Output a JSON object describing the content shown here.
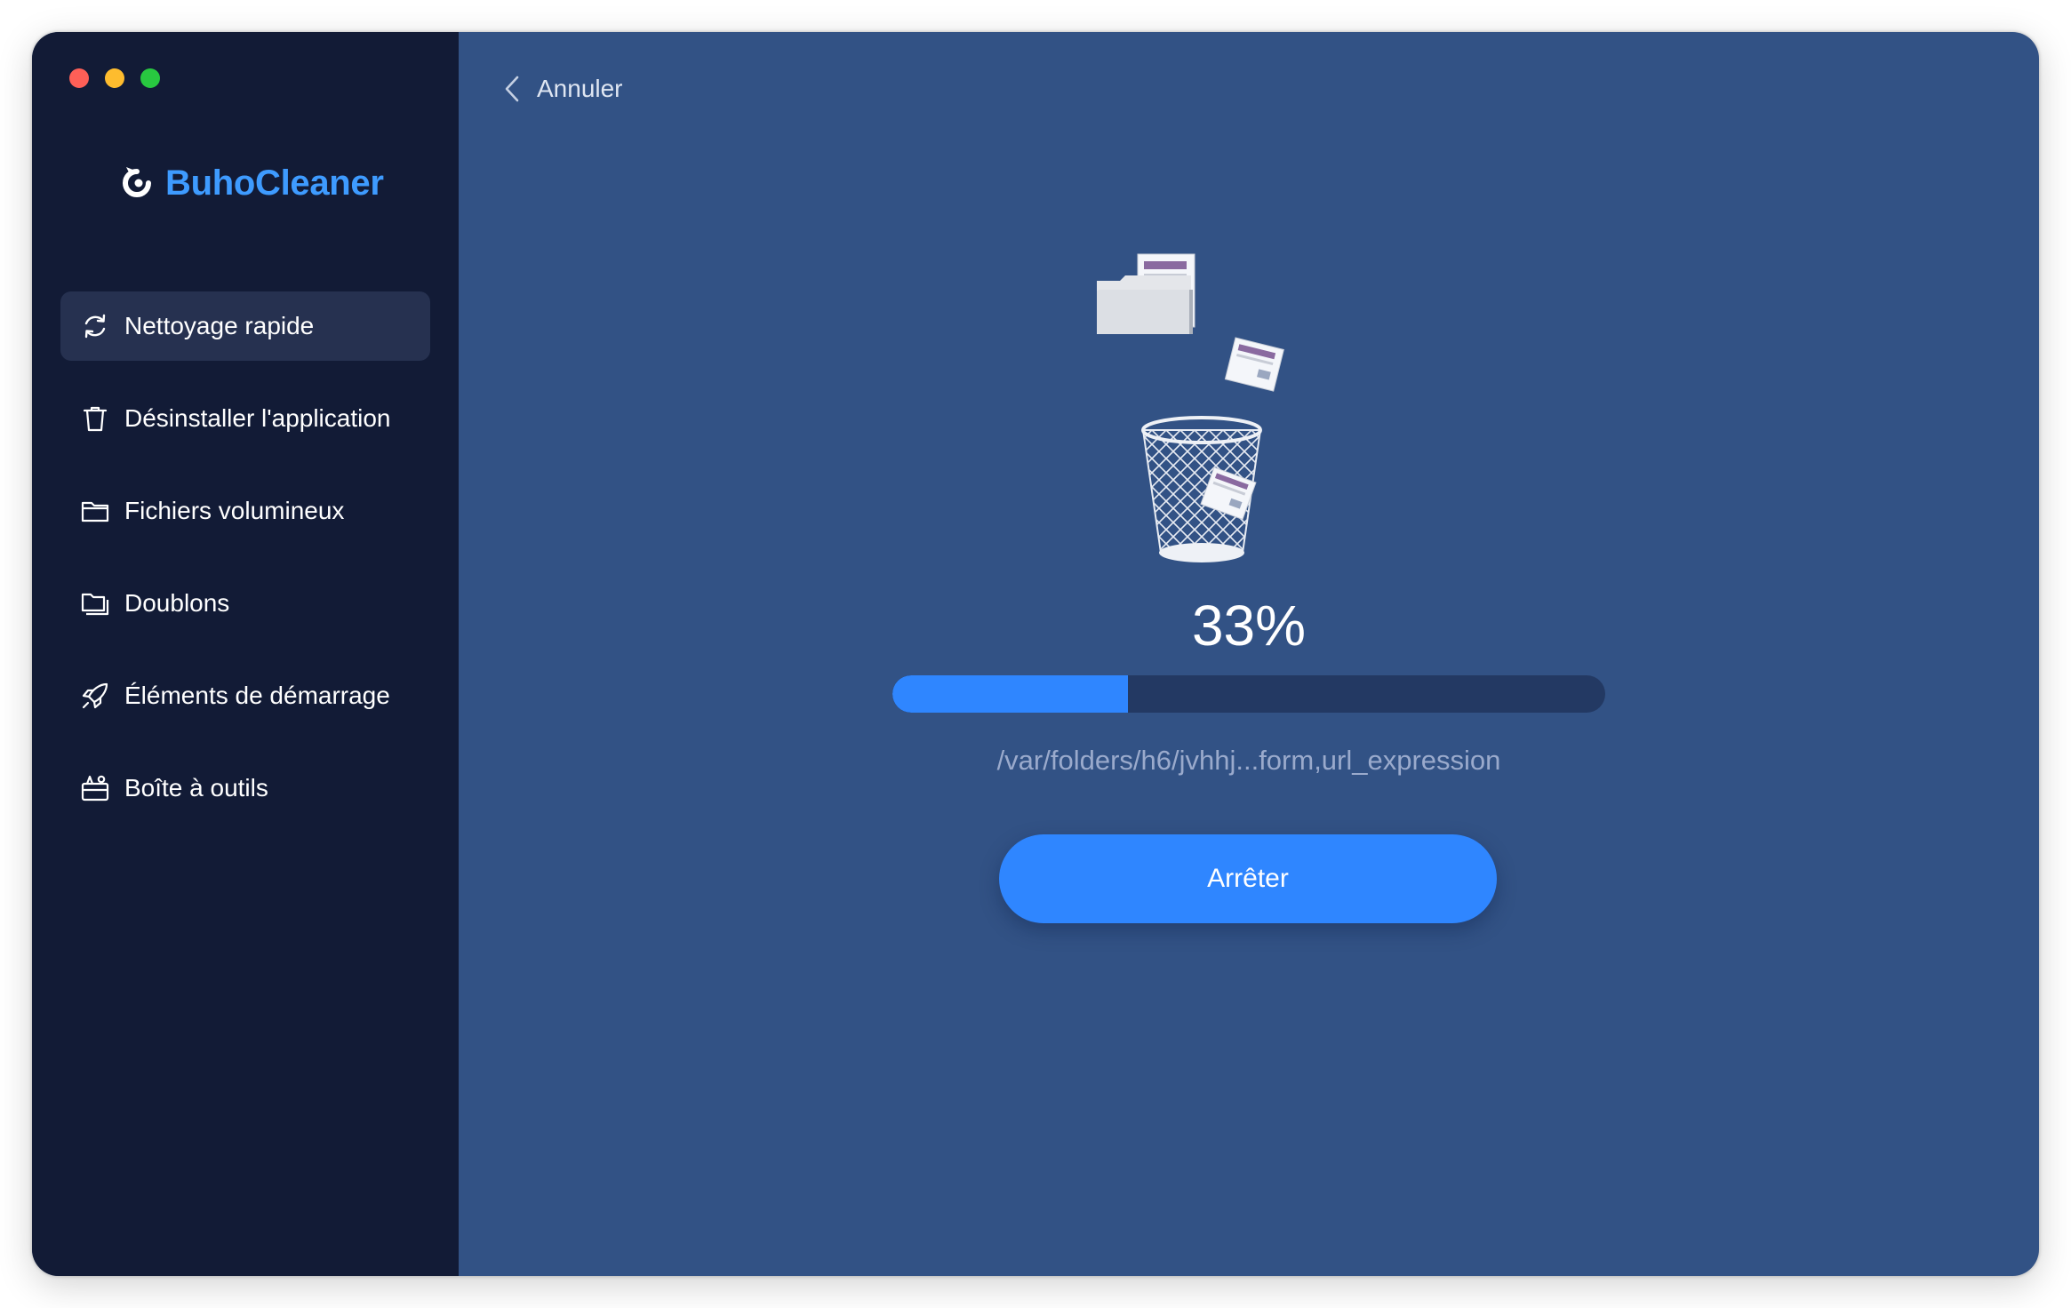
{
  "app": {
    "name": "BuhoCleaner",
    "brand_color": "#3e9bff"
  },
  "sidebar": {
    "items": [
      {
        "label": "Nettoyage rapide",
        "icon": "refresh-icon",
        "active": true
      },
      {
        "label": "Désinstaller l'application",
        "icon": "trash-icon",
        "active": false
      },
      {
        "label": "Fichiers volumineux",
        "icon": "folder-icon",
        "active": false
      },
      {
        "label": "Doublons",
        "icon": "duplicate-folder-icon",
        "active": false
      },
      {
        "label": "Éléments de démarrage",
        "icon": "rocket-icon",
        "active": false
      },
      {
        "label": "Boîte à outils",
        "icon": "toolbox-icon",
        "active": false
      }
    ]
  },
  "header": {
    "back_label": "Annuler"
  },
  "progress": {
    "percent_label": "33%",
    "value": 0.33,
    "current_path": "/var/folders/h6/jvhhj...form,url_expression",
    "fill_color": "#2f86ff",
    "track_color": "#233963"
  },
  "actions": {
    "stop_label": "Arrêter"
  }
}
